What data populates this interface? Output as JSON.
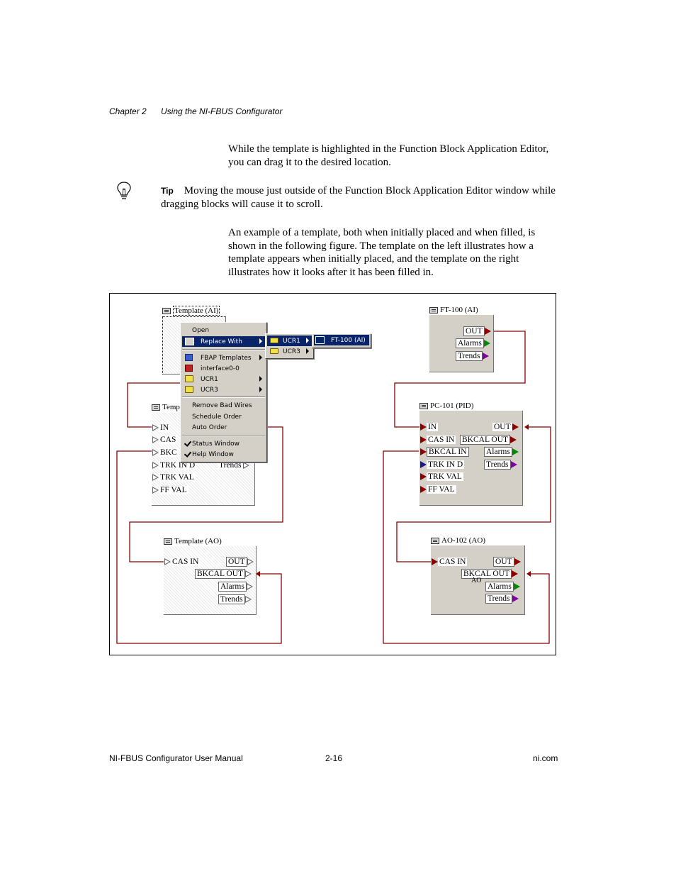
{
  "header": {
    "chapter": "Chapter 2",
    "title": "Using the NI-FBUS Configurator"
  },
  "body": {
    "para1": "While the template is highlighted in the Function Block Application Editor, you can drag it to the desired location.",
    "tip_label": "Tip",
    "tip_text": "Moving the mouse just outside of the Function Block Application Editor window while dragging blocks will cause it to scroll.",
    "para2": "An example of a template, both when initially placed and when filled, is shown in the following figure. The template on the left illustrates how a template appears when initially placed, and the template on the right illustrates how it looks after it has been filled in."
  },
  "figure": {
    "left": {
      "template_ai_title": "Template (AI)",
      "template_pid_title": "Temp",
      "pid_ports": [
        "IN",
        "CAS",
        "BKC",
        "TRK IN D",
        "TRK VAL",
        "FF VAL"
      ],
      "pid_trends": "Trends",
      "template_ao_title": "Template (AO)",
      "ao_ports": {
        "cas_in": "CAS IN",
        "out": "OUT",
        "bkcal_out": "BKCAL OUT",
        "alarms": "Alarms",
        "trends": "Trends"
      }
    },
    "context_menu": {
      "items": {
        "open": "Open",
        "replace_with": "Replace With",
        "fbap_templates": "FBAP Templates",
        "interface": "interface0-0",
        "ucr1": "UCR1",
        "ucr3": "UCR3",
        "remove_bad_wires": "Remove Bad Wires",
        "schedule_order": "Schedule Order",
        "auto_order": "Auto Order",
        "status_window": "Status Window",
        "help_window": "Help Window"
      },
      "submenu": {
        "ucr1": "UCR1",
        "ucr3": "UCR3"
      },
      "submenu2": {
        "ft100": "FT-100 (AI)"
      }
    },
    "right": {
      "ft100_title": "FT-100 (AI)",
      "ft100_ports": {
        "out": "OUT",
        "alarms": "Alarms",
        "trends": "Trends"
      },
      "pc101_title": "PC-101 (PID)",
      "pc101_ports": {
        "in": "IN",
        "out": "OUT",
        "cas_in": "CAS IN",
        "bkcal_out": "BKCAL OUT",
        "bkcal_in": "BKCAL IN",
        "alarms": "Alarms",
        "trk_in_d": "TRK IN D",
        "trends": "Trends",
        "trk_val": "TRK VAL",
        "ff_val": "FF VAL"
      },
      "ao102_title": "AO-102 (AO)",
      "ao102_ports": {
        "cas_in": "CAS IN",
        "out": "OUT",
        "bkcal_out": "BKCAL OUT",
        "alarms": "Alarms",
        "trends": "Trends"
      },
      "ao102_sub": "AO"
    },
    "wire_color": "#8b0000"
  },
  "footer": {
    "left": "NI-FBUS Configurator User Manual",
    "center": "2-16",
    "right": "ni.com"
  }
}
